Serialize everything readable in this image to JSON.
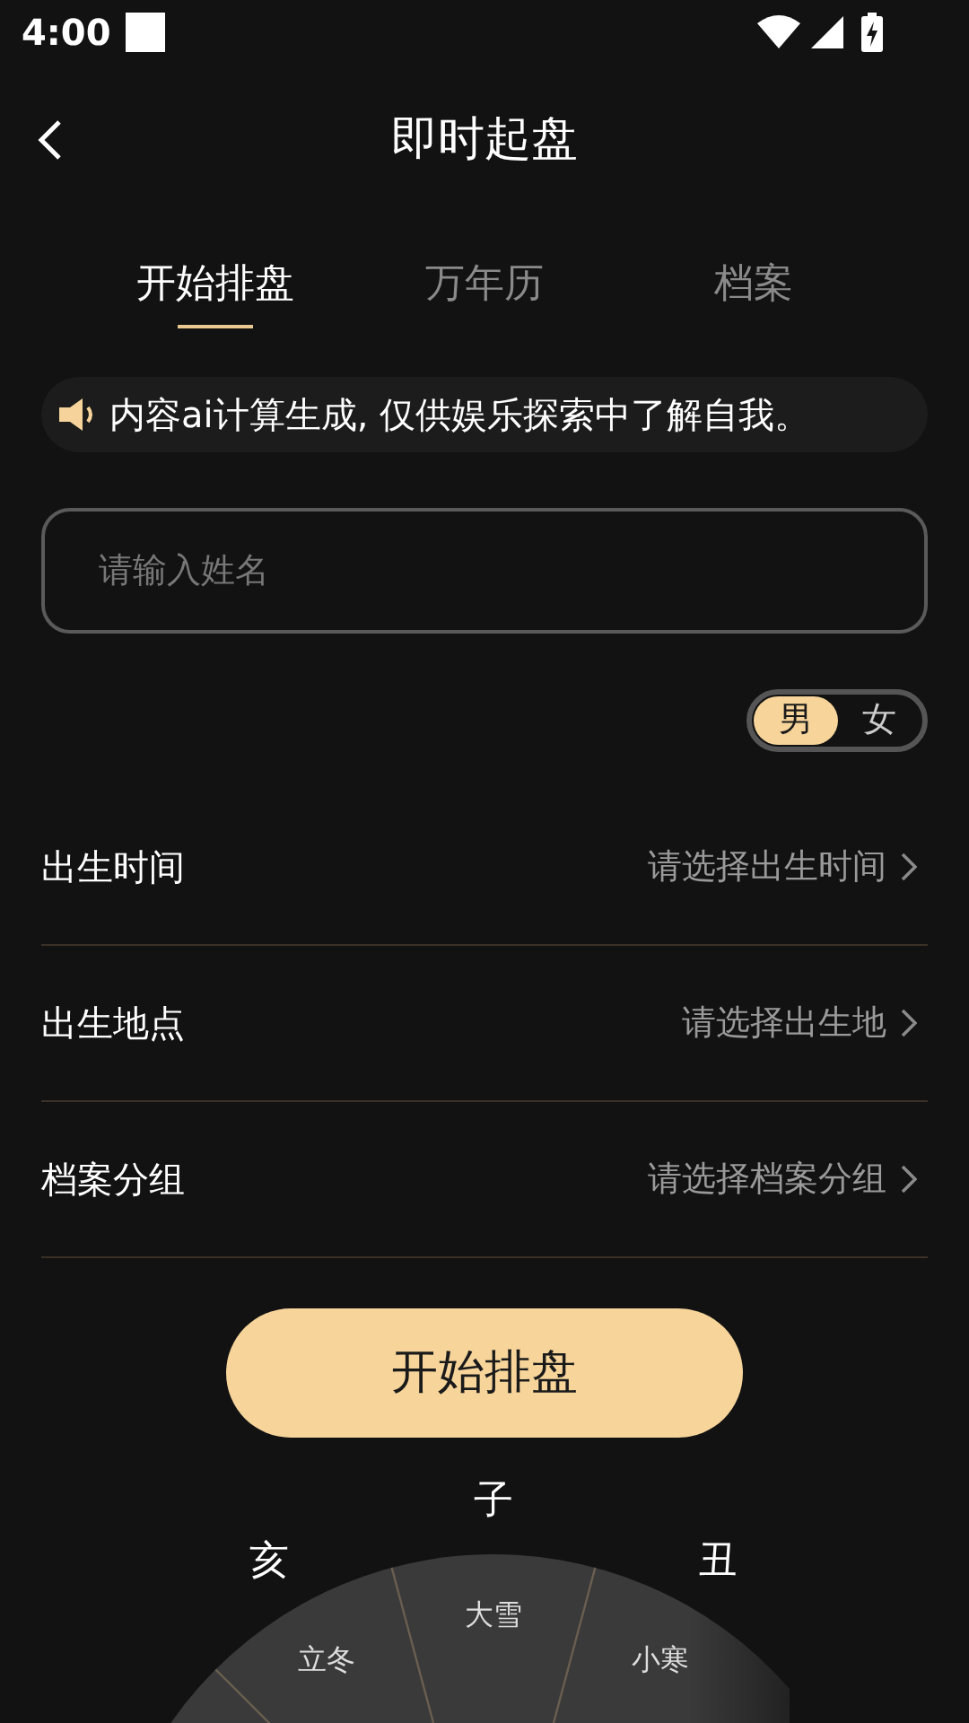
{
  "status_bar": {
    "time": "4:00"
  },
  "header": {
    "title": "即时起盘"
  },
  "tabs": [
    {
      "label": "开始排盘",
      "selected": true
    },
    {
      "label": "万年历",
      "selected": false
    },
    {
      "label": "档案",
      "selected": false
    }
  ],
  "notice": {
    "text": "内容ai计算生成, 仅供娱乐探索中了解自我。"
  },
  "name_field": {
    "placeholder": "请输入姓名"
  },
  "gender": [
    {
      "label": "男",
      "selected": true
    },
    {
      "label": "女",
      "selected": false
    }
  ],
  "rows": [
    {
      "label": "出生时间",
      "value": "请选择出生时间"
    },
    {
      "label": "出生地点",
      "value": "请选择出生地"
    },
    {
      "label": "档案分组",
      "value": "请选择档案分组"
    }
  ],
  "start_button": {
    "label": "开始排盘"
  },
  "wheel": {
    "branches": [
      {
        "branch": "亥",
        "term": "立冬"
      },
      {
        "branch": "子",
        "term": "大雪"
      },
      {
        "branch": "丑",
        "term": "小寒"
      }
    ]
  }
}
